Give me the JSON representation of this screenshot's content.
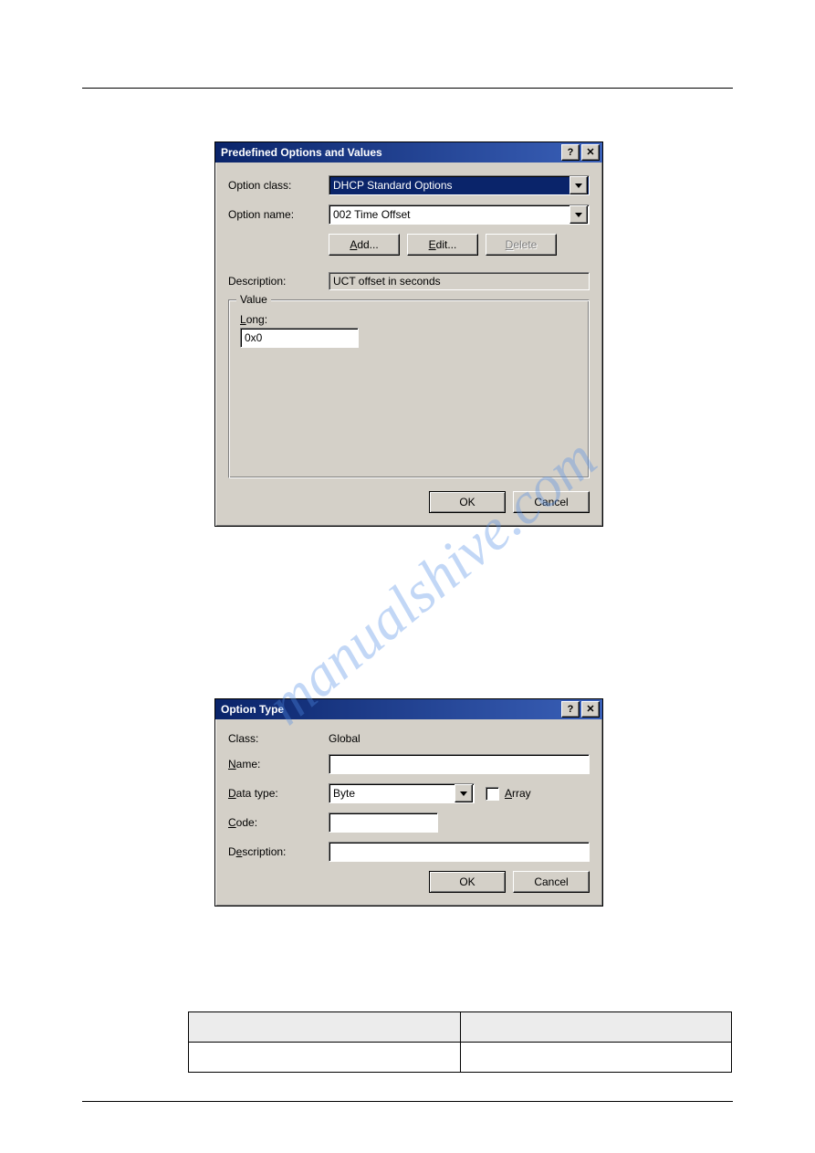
{
  "watermark": "manualshive.com",
  "dialog1": {
    "title": "Predefined Options and Values",
    "option_class_label": "Option class:",
    "option_class_value": "DHCP Standard Options",
    "option_name_label": "Option name:",
    "option_name_value": "002 Time Offset",
    "add_btn": "Add...",
    "edit_btn": "Edit...",
    "delete_btn": "Delete",
    "description_label": "Description:",
    "description_value": "UCT offset in seconds",
    "group_title": "Value",
    "long_label": "Long:",
    "long_value": "0x0",
    "ok": "OK",
    "cancel": "Cancel"
  },
  "dialog2": {
    "title": "Option Type",
    "class_label": "Class:",
    "class_value": "Global",
    "name_label": "Name:",
    "name_value": "",
    "data_type_label": "Data type:",
    "data_type_value": "Byte",
    "array_label": "Array",
    "code_label": "Code:",
    "code_value": "",
    "description_label": "Description:",
    "description_value": "",
    "ok": "OK",
    "cancel": "Cancel"
  },
  "table": {
    "h1": "",
    "h2": "",
    "d1": "",
    "d2": ""
  }
}
